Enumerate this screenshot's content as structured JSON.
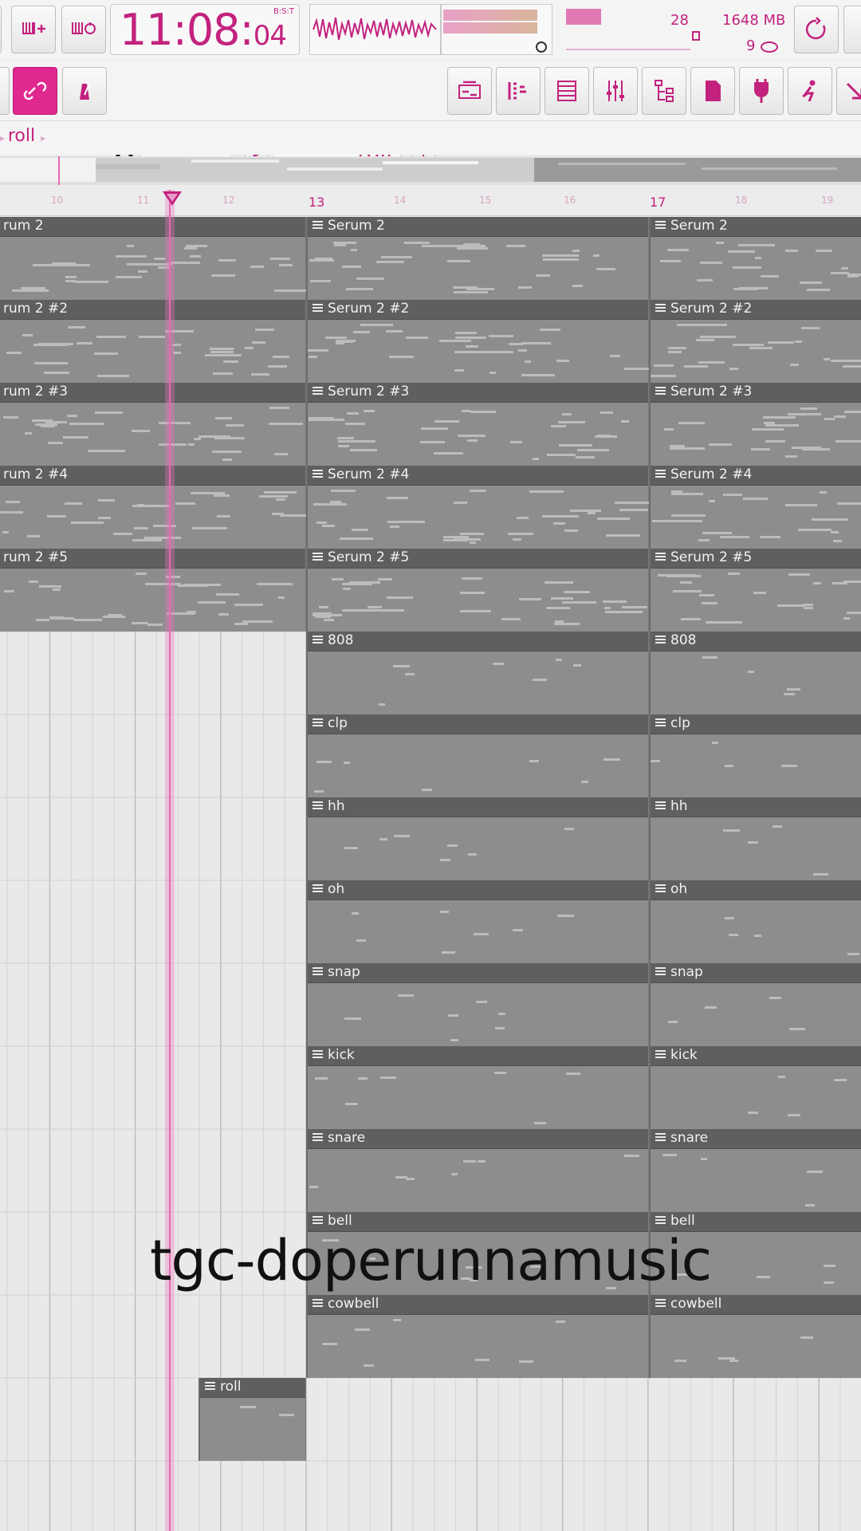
{
  "toolbar": {
    "clock_time_main": "11:08",
    "clock_time_sub": "04",
    "clock_format": "B:S:T",
    "cpu_value": "28",
    "memory": "1648 MB",
    "polyphony": "9",
    "snap_mode": "Line",
    "pattern_name": "roll",
    "pattern_add": "+"
  },
  "breadcrumb": {
    "item": "roll"
  },
  "ruler": {
    "bars": [
      "10",
      "11",
      "12",
      "13",
      "14",
      "15",
      "16",
      "17",
      "18",
      "19"
    ]
  },
  "tracks": [
    {
      "label_left": "rum 2",
      "label": "Serum 2"
    },
    {
      "label_left": "rum 2 #2",
      "label": "Serum 2 #2"
    },
    {
      "label_left": "rum 2 #3",
      "label": "Serum 2 #3"
    },
    {
      "label_left": "rum 2 #4",
      "label": "Serum 2 #4"
    },
    {
      "label_left": "rum 2 #5",
      "label": "Serum 2 #5"
    },
    {
      "label_left": "",
      "label": "808"
    },
    {
      "label_left": "",
      "label": "clp"
    },
    {
      "label_left": "",
      "label": "hh"
    },
    {
      "label_left": "",
      "label": "oh"
    },
    {
      "label_left": "",
      "label": "snap"
    },
    {
      "label_left": "",
      "label": "kick"
    },
    {
      "label_left": "",
      "label": "snare"
    },
    {
      "label_left": "",
      "label": "bell"
    },
    {
      "label_left": "",
      "label": "cowbell"
    }
  ],
  "roll_clip": {
    "label": "roll"
  },
  "watermark": "tgc-doperunnamusic",
  "colors": {
    "accent": "#c2227e",
    "clip": "#8d8d8d",
    "clip_header": "#5f5f5f",
    "playhead": "#e56bb3"
  },
  "icons": [
    "piano-plus-icon",
    "wave-loop-icon",
    "refresh-icon",
    "link-icon",
    "metronome-icon",
    "magnet-icon",
    "playlist-icon",
    "piano-roll-icon",
    "channel-rack-icon",
    "mixer-icon",
    "browser-icon",
    "file-icon",
    "plugin-icon",
    "person-icon",
    "arrow-icon"
  ]
}
